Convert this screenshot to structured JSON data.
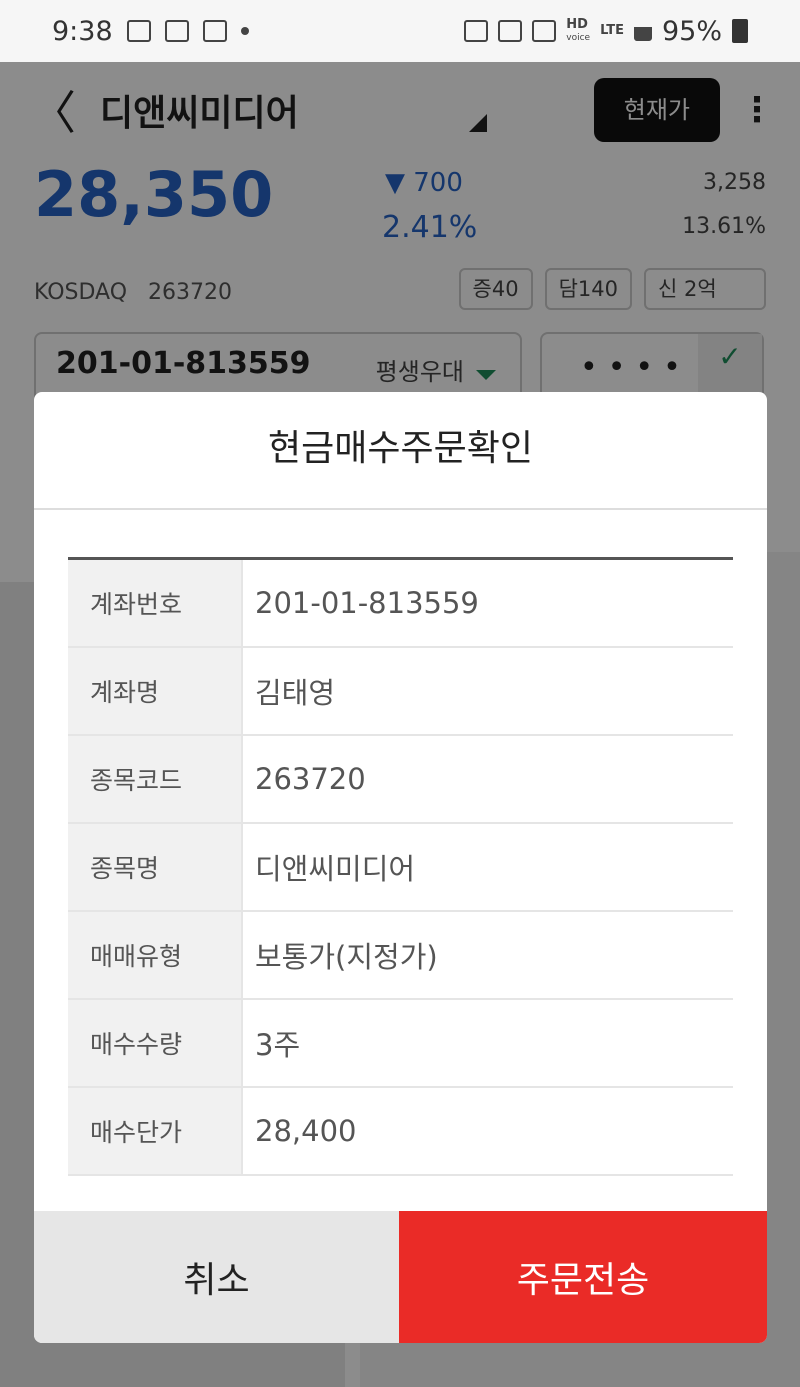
{
  "status_bar": {
    "time": "9:38",
    "net_hd": "HD",
    "net_voice": "voice",
    "net_lte": "LTE",
    "battery_pct": "95%"
  },
  "header": {
    "back_glyph": "〈",
    "stock_name": "디앤씨미디어",
    "current_price_button": "현재가",
    "menu_glyph": "⋮"
  },
  "quote": {
    "price": "28,350",
    "change": "▼ 700",
    "change_pct": "2.41%",
    "volume": "3,258",
    "volume_pct": "13.61%",
    "market": "KOSDAQ",
    "code": "263720",
    "tags": [
      "증40",
      "담140",
      "신 2억"
    ]
  },
  "account": {
    "number": "201-01-813559",
    "type": "평생우대",
    "password_mask": "••••",
    "check_glyph": "✓"
  },
  "dialog": {
    "title": "현금매수주문확인",
    "rows": [
      {
        "label": "계좌번호",
        "value": "201-01-813559"
      },
      {
        "label": "계좌명",
        "value": "김태영"
      },
      {
        "label": "종목코드",
        "value": "263720"
      },
      {
        "label": "종목명",
        "value": "디앤씨미디어"
      },
      {
        "label": "매매유형",
        "value": "보통가(지정가)"
      },
      {
        "label": "매수수량",
        "value": "3주"
      },
      {
        "label": "매수단가",
        "value": "28,400"
      }
    ],
    "cancel_label": "취소",
    "submit_label": "주문전송"
  },
  "colors": {
    "down_blue": "#2763c5",
    "submit_red": "#ea2b27",
    "accent_green": "#1e8d5a"
  }
}
